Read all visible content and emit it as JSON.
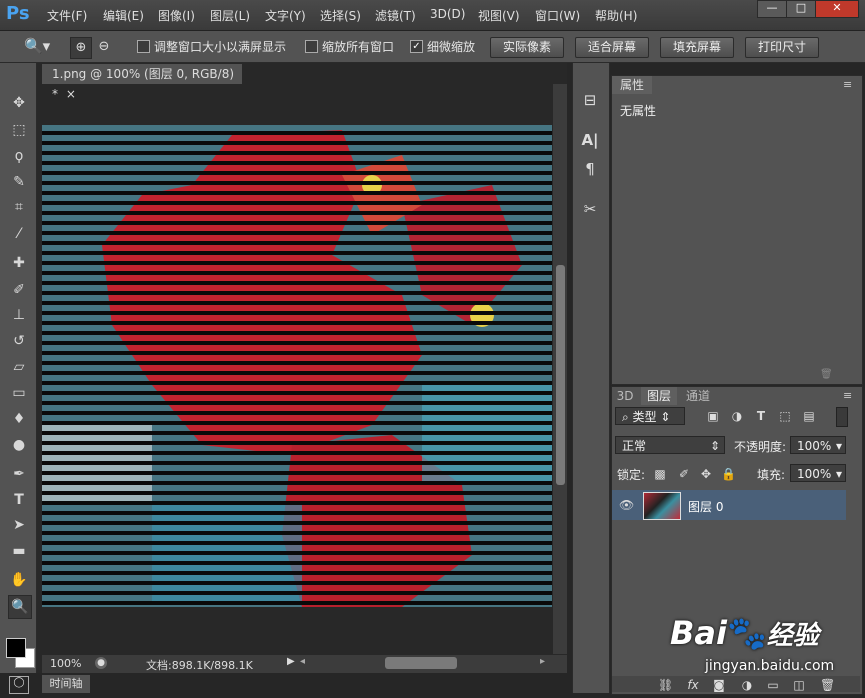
{
  "menu": [
    "文件(F)",
    "编辑(E)",
    "图像(I)",
    "图层(L)",
    "文字(Y)",
    "选择(S)",
    "滤镜(T)",
    "3D(D)",
    "视图(V)",
    "窗口(W)",
    "帮助(H)"
  ],
  "app_logo": "Ps",
  "window_buttons": {
    "minimize": "—",
    "restore": "□",
    "close": "✕"
  },
  "options": {
    "resize_windows": "调整窗口大小以满屏显示",
    "zoom_all": "缩放所有窗口",
    "scrubby_zoom": "细微缩放",
    "actual_pixels": "实际像素",
    "fit_screen": "适合屏幕",
    "fill_screen": "填充屏幕",
    "print_size": "打印尺寸"
  },
  "document": {
    "tab_title": "1.png @ 100% (图层 0, RGB/8) *",
    "tab_close": "×",
    "zoom": "100%",
    "doc_info": "文档:898.1K/898.1K"
  },
  "timeline_tab": "时间轴",
  "properties": {
    "tab": "属性",
    "content": "无属性"
  },
  "layers": {
    "tabs": [
      "3D",
      "图层",
      "通道"
    ],
    "filter_kind": "类型",
    "blend_mode": "正常",
    "opacity_label": "不透明度:",
    "opacity_value": "100%",
    "lock_label": "锁定:",
    "fill_label": "填充:",
    "fill_value": "100%",
    "layer_name": "图层 0"
  },
  "watermark": {
    "brand": "Bai",
    "brand_cn": "经验",
    "url": "jingyan.baidu.com"
  },
  "colors": {
    "accent": "#4aa3f0",
    "selected_layer": "#4a6079",
    "panel": "#535353"
  }
}
